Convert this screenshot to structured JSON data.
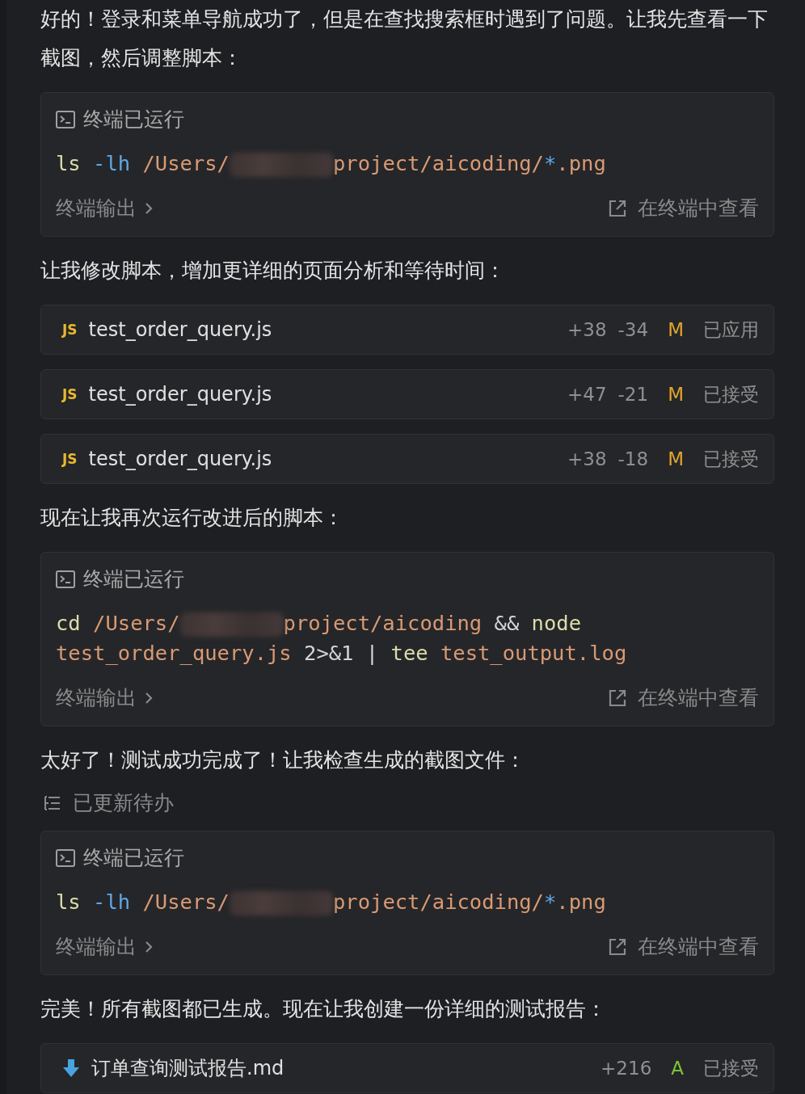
{
  "blocks": [
    {
      "kind": "paragraph",
      "text": "好的！登录和菜单导航成功了，但是在查找搜索框时遇到了问题。让我先查看一下截图，然后调整脚本："
    },
    {
      "kind": "terminal",
      "title": "终端已运行",
      "lines": [
        [
          {
            "kind": "cmd",
            "text": "ls"
          },
          {
            "kind": "flag",
            "text": " -lh"
          },
          {
            "kind": "str",
            "text": " /Users/"
          },
          {
            "kind": "redacted"
          },
          {
            "kind": "str",
            "text": "project/aicoding/"
          },
          {
            "kind": "flag",
            "text": "*"
          },
          {
            "kind": "str",
            "text": ".png"
          }
        ]
      ],
      "output_label": "终端输出",
      "open_label": "在终端中查看"
    },
    {
      "kind": "paragraph",
      "text": "让我修改脚本，增加更详细的页面分析和等待时间："
    },
    {
      "kind": "file",
      "icon": {
        "kind": "js",
        "label": "JS"
      },
      "name": "test_order_query.js",
      "added": "+38",
      "removed": "-34",
      "status": "M",
      "color": "#e2a52c",
      "state": "已应用"
    },
    {
      "kind": "file",
      "icon": {
        "kind": "js",
        "label": "JS"
      },
      "name": "test_order_query.js",
      "added": "+47",
      "removed": "-21",
      "status": "M",
      "color": "#e2a52c",
      "state": "已接受"
    },
    {
      "kind": "file",
      "icon": {
        "kind": "js",
        "label": "JS"
      },
      "name": "test_order_query.js",
      "added": "+38",
      "removed": "-18",
      "status": "M",
      "color": "#e2a52c",
      "state": "已接受"
    },
    {
      "kind": "paragraph",
      "text": "现在让我再次运行改进后的脚本："
    },
    {
      "kind": "terminal",
      "title": "终端已运行",
      "lines": [
        [
          {
            "kind": "cmd",
            "text": "cd"
          },
          {
            "kind": "str",
            "text": " /Users/"
          },
          {
            "kind": "redacted"
          },
          {
            "kind": "str",
            "text": "project/aicoding"
          },
          {
            "kind": "op",
            "text": " &&"
          },
          {
            "kind": "cmd",
            "text": " node"
          }
        ],
        [
          {
            "kind": "str",
            "text": "test_order_query.js"
          },
          {
            "kind": "op",
            "text": " 2>&1 |"
          },
          {
            "kind": "cmd",
            "text": " tee"
          },
          {
            "kind": "str",
            "text": " test_output.log"
          }
        ]
      ],
      "output_label": "终端输出",
      "open_label": "在终端中查看"
    },
    {
      "kind": "paragraph",
      "text": "太好了！测试成功完成了！让我检查生成的截图文件："
    },
    {
      "kind": "todo",
      "text": "已更新待办"
    },
    {
      "kind": "terminal",
      "title": "终端已运行",
      "lines": [
        [
          {
            "kind": "cmd",
            "text": "ls"
          },
          {
            "kind": "flag",
            "text": " -lh"
          },
          {
            "kind": "str",
            "text": " /Users/"
          },
          {
            "kind": "redacted"
          },
          {
            "kind": "str",
            "text": "project/aicoding/"
          },
          {
            "kind": "flag",
            "text": "*"
          },
          {
            "kind": "str",
            "text": ".png"
          }
        ]
      ],
      "output_label": "终端输出",
      "open_label": "在终端中查看"
    },
    {
      "kind": "paragraph",
      "text": "完美！所有截图都已生成。现在让我创建一份详细的测试报告："
    },
    {
      "kind": "file",
      "icon": {
        "kind": "md"
      },
      "name": "订单查询测试报告.md",
      "added": "+216",
      "status": "A",
      "color": "#7cc23a",
      "state": "已接受"
    }
  ]
}
